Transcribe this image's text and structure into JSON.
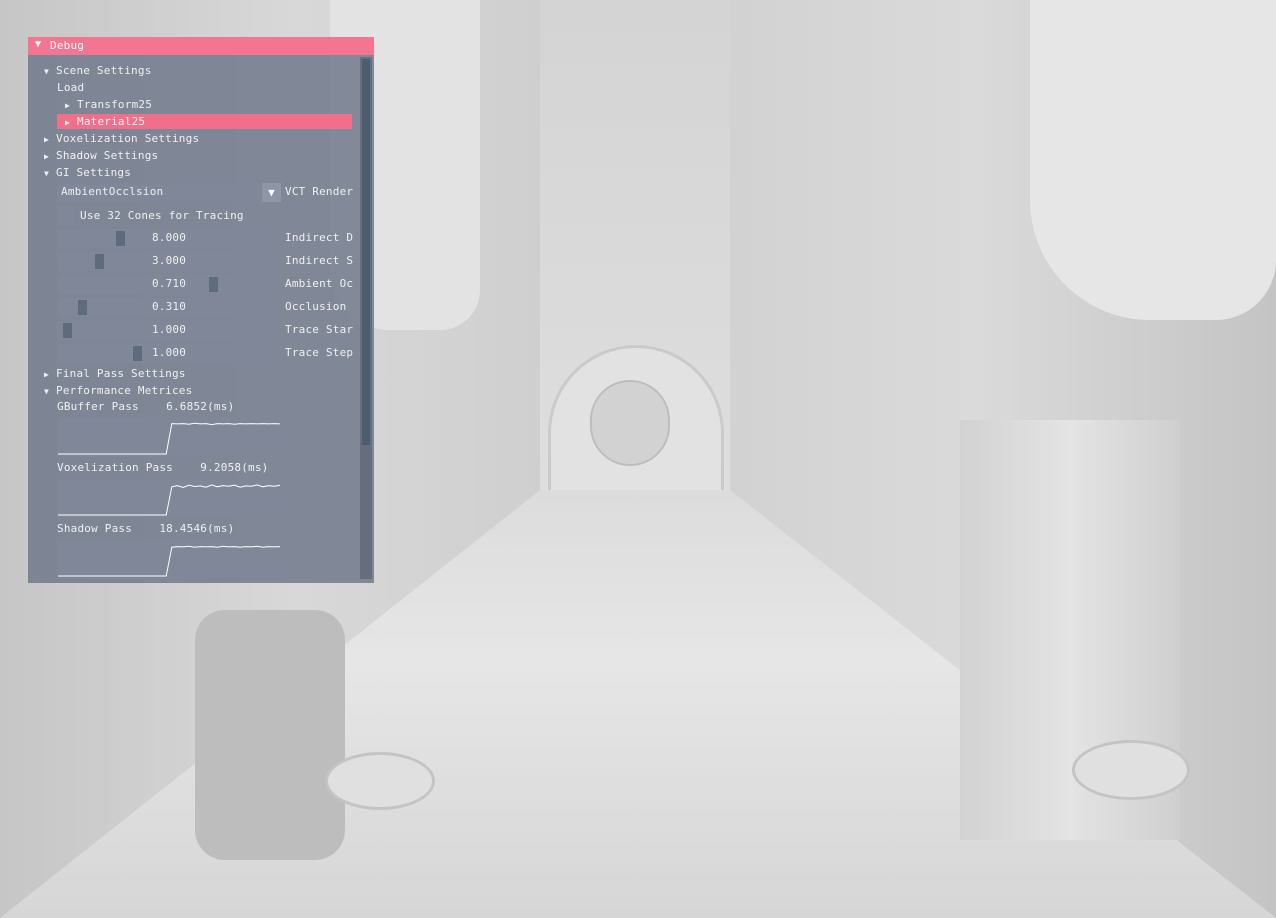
{
  "window": {
    "title": "Debug"
  },
  "tree": {
    "scene_settings": "Scene Settings",
    "load": "Load",
    "transform": "Transform25",
    "material": "Material25",
    "voxelization_settings": "Voxelization Settings",
    "shadow_settings": "Shadow Settings",
    "gi_settings": "GI Settings",
    "final_pass_settings": "Final Pass Settings",
    "performance_metrics": "Performance Metrices"
  },
  "gi": {
    "render_mode": {
      "value": "AmbientOcclsion",
      "label": "VCT Render"
    },
    "cones_checkbox": {
      "label": "Use 32 Cones for Tracing",
      "checked": false
    },
    "sliders": [
      {
        "value": "8.000",
        "label": "Indirect D",
        "level": 0.27
      },
      {
        "value": "3.000",
        "label": "Indirect S",
        "level": 0.17
      },
      {
        "value": "0.710",
        "label": "Ambient Oc",
        "level": 0.71
      },
      {
        "value": "0.310",
        "label": "Occlusion",
        "level": 0.09
      },
      {
        "value": "1.000",
        "label": "Trace Star",
        "level": 0.02
      },
      {
        "value": "1.000",
        "label": "Trace Step",
        "level": 0.35
      }
    ]
  },
  "metrics": [
    {
      "label": "GBuffer Pass",
      "value": "6.6852(ms)",
      "level": [
        0.0,
        0.0,
        0.0,
        0.0,
        0.0,
        0.0,
        0.0,
        0.0,
        0.0,
        0.0,
        0.0,
        0.0,
        0.0,
        0.0,
        0.0,
        0.0,
        0.0,
        0.0,
        0.0,
        0.0,
        0.95,
        0.94,
        0.95,
        0.93,
        0.96,
        0.94,
        0.95,
        0.92,
        0.95,
        0.94,
        0.95,
        0.93,
        0.95,
        0.94,
        0.95,
        0.94,
        0.95,
        0.94,
        0.95,
        0.94
      ]
    },
    {
      "label": "Voxelization Pass",
      "value": "9.2058(ms)",
      "level": [
        0.0,
        0.0,
        0.0,
        0.0,
        0.0,
        0.0,
        0.0,
        0.0,
        0.0,
        0.0,
        0.0,
        0.0,
        0.0,
        0.0,
        0.0,
        0.0,
        0.0,
        0.0,
        0.0,
        0.0,
        0.88,
        0.92,
        0.86,
        0.93,
        0.89,
        0.91,
        0.87,
        0.94,
        0.88,
        0.92,
        0.9,
        0.93,
        0.87,
        0.91,
        0.9,
        0.94,
        0.88,
        0.92,
        0.9,
        0.93
      ]
    },
    {
      "label": "Shadow Pass",
      "value": "18.4546(ms)",
      "level": [
        0.0,
        0.0,
        0.0,
        0.0,
        0.0,
        0.0,
        0.0,
        0.0,
        0.0,
        0.0,
        0.0,
        0.0,
        0.0,
        0.0,
        0.0,
        0.0,
        0.0,
        0.0,
        0.0,
        0.0,
        0.9,
        0.92,
        0.91,
        0.93,
        0.9,
        0.92,
        0.91,
        0.92,
        0.9,
        0.93,
        0.91,
        0.92,
        0.9,
        0.92,
        0.91,
        0.93,
        0.9,
        0.92,
        0.91,
        0.92
      ]
    }
  ],
  "colors": {
    "title_bar": "#f4758f",
    "highlight": "#f0708b",
    "widget": "#7f8798",
    "plot_line": "#ffffff"
  }
}
